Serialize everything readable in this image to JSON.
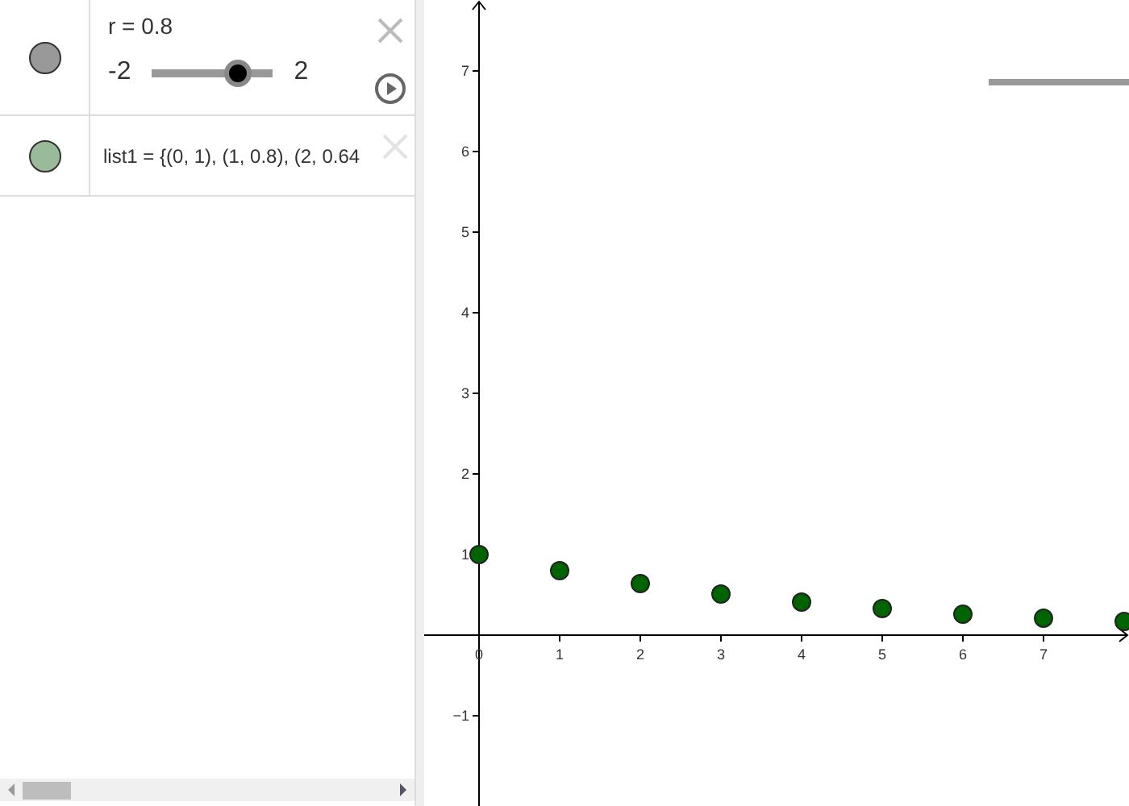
{
  "algebra": {
    "items": [
      {
        "kind": "slider",
        "color": "#999999",
        "label": "r = 0.8",
        "min": "-2",
        "max": "2",
        "level": 0.7
      },
      {
        "kind": "list",
        "color": "#99bb99",
        "label": "list1 = {(0, 1), (1, 0.8), (2, 0.64"
      }
    ]
  },
  "graphics": {
    "chart_data": {
      "type": "scatter",
      "x": [
        0,
        1,
        2,
        3,
        4,
        5,
        6,
        7,
        8
      ],
      "series": [
        {
          "color": "#006400",
          "values": [
            1,
            0.8,
            0.64,
            0.51,
            0.41,
            0.33,
            0.26,
            0.21,
            0.17
          ]
        }
      ],
      "xlim": [
        -0.68,
        8.06
      ],
      "ylim": [
        -2.12,
        7.88
      ],
      "xticks": [
        0,
        1,
        2,
        3,
        4,
        5,
        6,
        7
      ],
      "yticks": [
        -1,
        1,
        2,
        3,
        4,
        5,
        6,
        7
      ]
    }
  }
}
